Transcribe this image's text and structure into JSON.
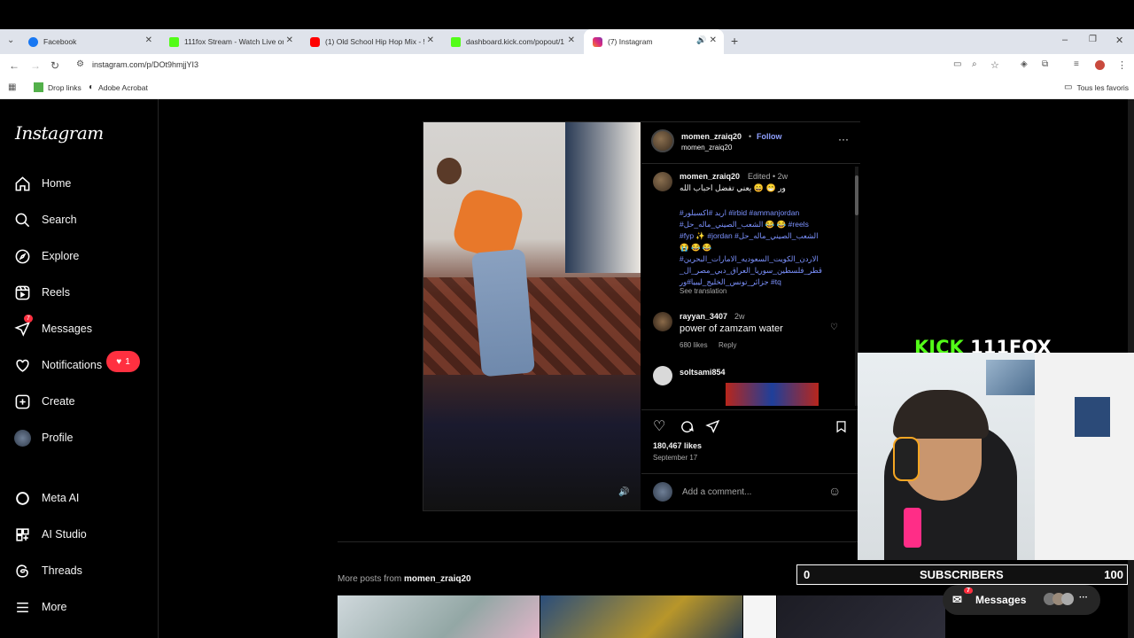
{
  "browser": {
    "tabs": [
      {
        "title": "Facebook",
        "color": "#1877f2"
      },
      {
        "title": "111fox Stream - Watch Live on",
        "color": "#53fc18"
      },
      {
        "title": "(1) Old School Hip Hop Mix - 5",
        "color": "#ff0000"
      },
      {
        "title": "dashboard.kick.com/popout/1",
        "color": "#53fc18"
      },
      {
        "title": "(7) Instagram",
        "color": "#e1306c"
      }
    ],
    "url": "instagram.com/p/DOt9hmjjYI3",
    "bookmarks": [
      "Drop links",
      "Adobe Acrobat"
    ],
    "bookmarks_right": "Tous les favoris"
  },
  "instagram": {
    "logo": "Instagram",
    "nav": {
      "home": "Home",
      "search": "Search",
      "explore": "Explore",
      "reels": "Reels",
      "messages": "Messages",
      "messages_badge": "7",
      "notifications": "Notifications",
      "notifications_count": "1",
      "create": "Create",
      "profile": "Profile",
      "meta_ai": "Meta AI",
      "ai_studio": "AI Studio",
      "threads": "Threads",
      "more": "More"
    },
    "post": {
      "username": "momen_zraiq20",
      "follow": "Follow",
      "subtitle": "momen_zraiq20",
      "caption_user": "momen_zraiq20",
      "caption_meta": "Edited • 2w",
      "caption_text": "ور 😁 😄 يعني تفضل احباب الله",
      "hashtags_1": "#اربد #اكسبلور #irbid #ammanjordan",
      "hashtags_2": "#الشعب_الصيني_ماله_حل 😂 😂 #reels",
      "hashtags_3": "#fyp ✨ #jordan #الشعب_الصيني_ماله_حل",
      "hashtags_4": "😭 😂 😂",
      "hashtags_5": "#الاردن_الكويت_السعوديه_الامارات_البحرين",
      "hashtags_6": "_قطر_فلسطين_سوريا_العراق_دبي_مصر_ال",
      "hashtags_7": "جزائر_تونس_الخليج_ليبيا#ور #tq",
      "see_translation": "See translation",
      "comment1_user": "rayyan_3407",
      "comment1_time": "2w",
      "comment1_text": "power of zamzam water",
      "comment1_likes": "680 likes",
      "comment1_reply": "Reply",
      "comment2_user": "soltsami854",
      "likes": "180,467 likes",
      "date": "September 17",
      "add_comment": "Add a comment..."
    },
    "more_posts_label": "More posts from",
    "more_posts_user": "momen_zraiq20"
  },
  "stream_overlay": {
    "kick": "KICK",
    "channel": "111FOX",
    "sub_current": "0",
    "sub_label": "SUBSCRIBERS",
    "sub_goal": "100",
    "messages": "Messages",
    "messages_badge": "7"
  }
}
